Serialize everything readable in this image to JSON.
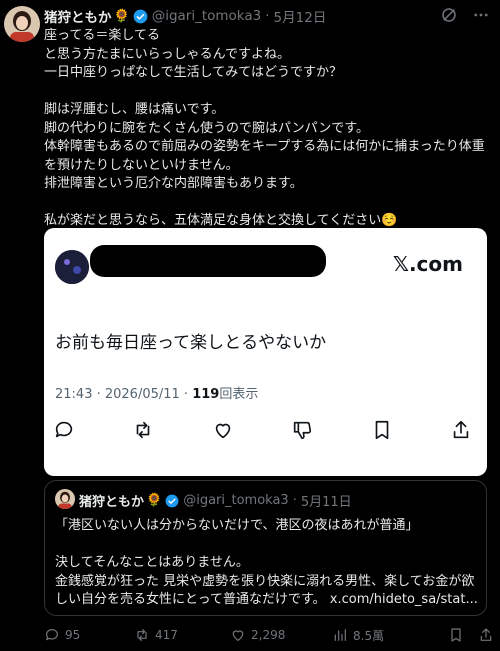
{
  "tweet": {
    "author_name": "猪狩ともか",
    "author_emoji": "🌻",
    "handle": "@igari_tomoka3",
    "separator": "·",
    "date": "5月12日",
    "text": "座ってる＝楽してる\nと思う方たまにいらっしゃるんですよね。\n一日中座りっぱなしで生活してみてはどうですか？\n\n脚は浮腫むし、腰は痛いです。\n脚の代わりに腕をたくさん使うので腕はパンパンです。\n体幹障害もあるので前屈みの姿勢をキープする為には何かに捕まったり体重を預けたりしないといけません。\n排泄障害という厄介な内部障害もあります。\n\n私が楽だと思うなら、五体満足な身体と交換してください☺️"
  },
  "card": {
    "logo": "𝕏.com",
    "body": "お前も毎日座って楽しとるやないか",
    "time": "21:43 · 2026/05/11 · ",
    "views_count": "119",
    "views_label": "回表示",
    "icons": [
      "reply-icon",
      "retweet-icon",
      "like-icon",
      "dislike-icon",
      "bookmark-icon",
      "share-icon"
    ]
  },
  "quote": {
    "author_name": "猪狩ともか",
    "author_emoji": "🌻",
    "handle": "@igari_tomoka3",
    "separator": "·",
    "date": "5月11日",
    "text": "「港区いない人は分からないだけで、港区の夜はあれが普通」\n\n決してそんなことはありません。\n金銭感覚が狂った 見栄や虚勢を張り快楽に溺れる男性、楽してお金が欲しい自分を売る女性にとって普通なだけです。 ",
    "link": "x.com/hideto_sa/stat..."
  },
  "stats": {
    "replies": "95",
    "retweets": "417",
    "likes": "2,298",
    "views": "8.5萬"
  },
  "colors": {
    "background": "#000000",
    "text": "#e7e9ea",
    "muted": "#71767b",
    "verified": "#1d9bf0"
  }
}
